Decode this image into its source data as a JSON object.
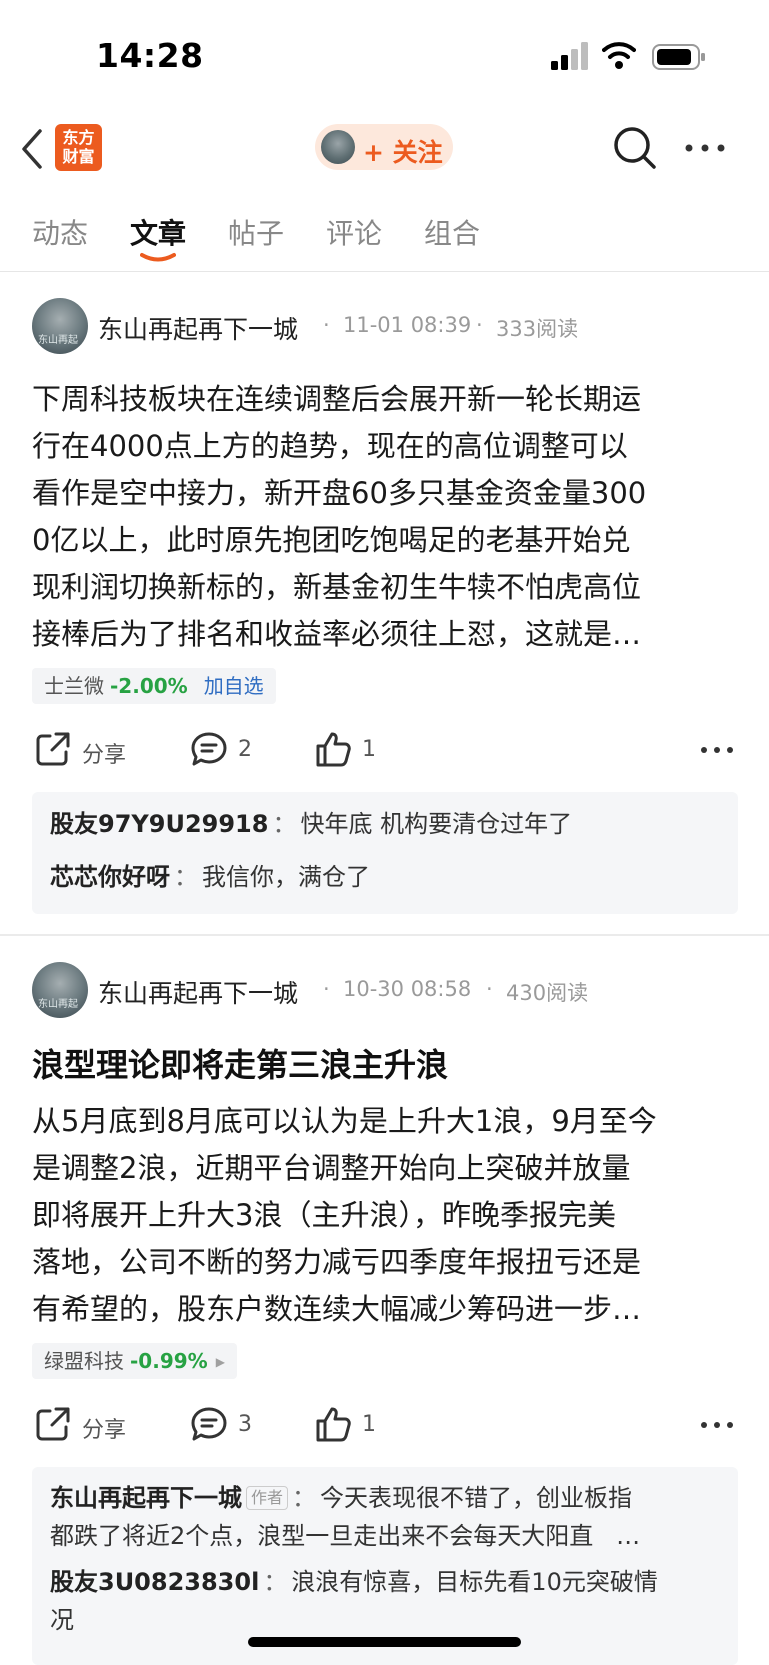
{
  "status_bar": {
    "time": "14:28"
  },
  "nav": {
    "logo_text_line1": "东方",
    "logo_text_line2": "财富",
    "follow_label": "+ 关注"
  },
  "tabs": [
    {
      "label": "动态"
    },
    {
      "label": "文章"
    },
    {
      "label": "帖子"
    },
    {
      "label": "评论"
    },
    {
      "label": "组合"
    }
  ],
  "active_tab": "文章",
  "posts": [
    {
      "author": "东山再起再下一城",
      "avatar_text": "东山再起",
      "time": "11-01 08:39",
      "reads": "333阅读",
      "title": "",
      "body_lines": [
        "下周科技板块在连续调整后会展开新一轮长期运",
        "行在4000点上方的趋势，现在的高位调整可以",
        "看作是空中接力，新开盘60多只基金资金量300",
        "0亿以上，此时原先抱团吃饱喝足的老基开始兑",
        "现利润切换新标的，新基金初生牛犊不怕虎高位",
        "接棒后为了排名和收益率必须往上怼，这就是…"
      ],
      "stock": {
        "name": "士兰微",
        "change": "-2.00%",
        "add_label": "加自选"
      },
      "share_label": "分享",
      "comment_count": "2",
      "like_count": "1",
      "comments": [
        {
          "user": "股友97Y9U29918",
          "is_author": false,
          "text": "快年底 机构要清仓过年了"
        },
        {
          "user": "芯芯你好呀",
          "is_author": false,
          "text": "我信你，满仓了"
        }
      ]
    },
    {
      "author": "东山再起再下一城",
      "avatar_text": "东山再起",
      "time": "10-30 08:58",
      "reads": "430阅读",
      "title": "浪型理论即将走第三浪主升浪",
      "body_lines": [
        "从5月底到8月底可以认为是上升大1浪，9月至今",
        "是调整2浪，近期平台调整开始向上突破并放量",
        "即将展开上升大3浪（主升浪），昨晚季报完美",
        "落地，公司不断的努力减亏四季度年报扭亏还是",
        "有希望的，股东户数连续大幅减少筹码进一步…"
      ],
      "stock": {
        "name": "绿盟科技",
        "change": "-0.99%",
        "add_label": ""
      },
      "share_label": "分享",
      "comment_count": "3",
      "like_count": "1",
      "comments": [
        {
          "user": "东山再起再下一城",
          "is_author": true,
          "author_tag": "作者",
          "text_line1": "今天表现很不错了，创业板指",
          "text_line2": "都跌了将近2个点，浪型一旦走出来不会每天大阳直",
          "ellipsis": "…"
        },
        {
          "user": "股友3U0823830l",
          "is_author": false,
          "text_line1": "浪浪有惊喜，目标先看10元突破情",
          "text_line2": "况"
        }
      ]
    }
  ],
  "separator": "·",
  "colon": "："
}
